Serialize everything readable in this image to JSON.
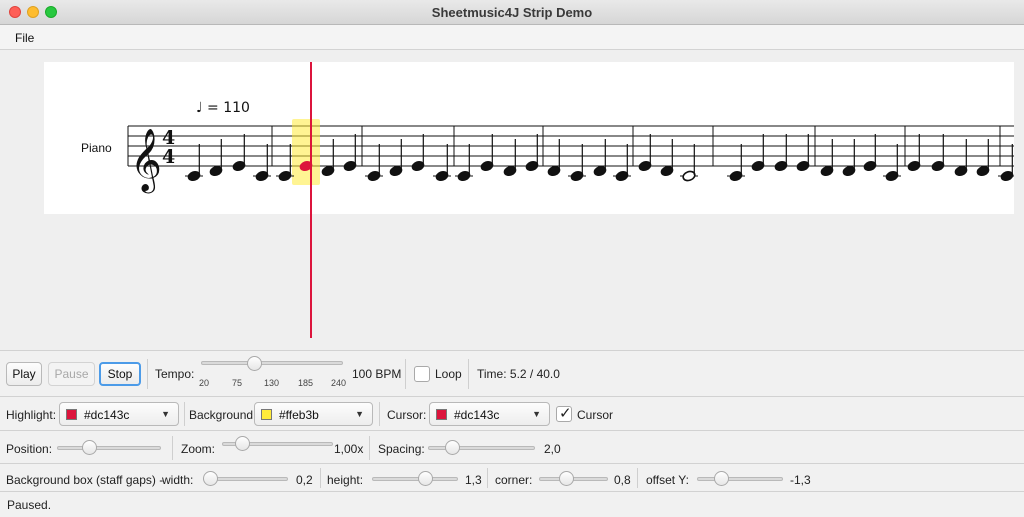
{
  "window": {
    "title": "Sheetmusic4J Strip Demo"
  },
  "menu": {
    "file": "File"
  },
  "score": {
    "instrument": "Piano",
    "tempo_text": "♩ = 110",
    "time_signature": {
      "top": "4",
      "bottom": "4"
    },
    "highlight_color": "#ffeb3b",
    "cursor_color": "#dc143c",
    "current_note_color": "#dc143c"
  },
  "transport": {
    "play_label": "Play",
    "pause_label": "Pause",
    "stop_label": "Stop",
    "tempo_label": "Tempo:",
    "tempo_ticks": [
      "20",
      "75",
      "130",
      "185",
      "240"
    ],
    "tempo_value": "100 BPM",
    "tempo_bpm": 100,
    "loop_label": "Loop",
    "loop_checked": false,
    "time_text": "Time: 5.2 / 40.0"
  },
  "colors": {
    "highlight_label": "Highlight:",
    "highlight_value": "#dc143c",
    "background_label": "Background:",
    "background_value": "#ffeb3b",
    "cursor_label": "Cursor:",
    "cursor_value": "#dc143c",
    "cursor_checkbox_label": "Cursor",
    "cursor_checked": true
  },
  "view": {
    "position_label": "Position:",
    "zoom_label": "Zoom:",
    "zoom_value": "1,00x",
    "spacing_label": "Spacing:",
    "spacing_value": "2,0"
  },
  "bgbox": {
    "title": "Background box (staff gaps) -",
    "width_label": "width:",
    "width_value": "0,2",
    "height_label": "height:",
    "height_value": "1,3",
    "corner_label": "corner:",
    "corner_value": "0,8",
    "offset_label": "offset Y:",
    "offset_value": "-1,3"
  },
  "status": {
    "text": "Paused."
  }
}
